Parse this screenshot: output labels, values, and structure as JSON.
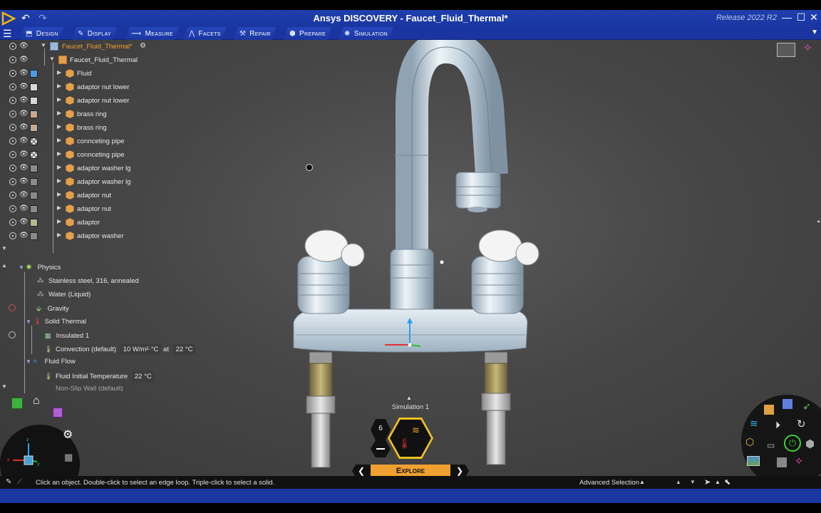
{
  "window": {
    "title": "Ansys DISCOVERY - Faucet_Fluid_Thermal*",
    "release": "Release 2022 R2"
  },
  "ribbon": {
    "tabs": [
      {
        "label": "Design",
        "icon": "design-icon"
      },
      {
        "label": "Display",
        "icon": "display-icon"
      },
      {
        "label": "Measure",
        "icon": "measure-icon"
      },
      {
        "label": "Facets",
        "icon": "facets-icon"
      },
      {
        "label": "Repair",
        "icon": "repair-icon"
      },
      {
        "label": "Prepare",
        "icon": "prepare-icon"
      },
      {
        "label": "Simulation",
        "icon": "simulation-icon"
      }
    ]
  },
  "tree": {
    "root": "Faucet_Fluid_Thermal*",
    "child": "Faucet_Fluid_Thermal",
    "items": [
      {
        "label": "Fluid",
        "color": "#4b9be0"
      },
      {
        "label": "adaptor nut lower",
        "color": "#d8d8d8"
      },
      {
        "label": "adaptor nut lower",
        "color": "#d8d8d8"
      },
      {
        "label": "brass ring",
        "color": "#c8a890"
      },
      {
        "label": "brass ring",
        "color": "#c8a890"
      },
      {
        "label": "connceting pipe",
        "color": "checker"
      },
      {
        "label": "connceting pipe",
        "color": "checker"
      },
      {
        "label": "adaptor washer lg",
        "color": "#8a8a8a"
      },
      {
        "label": "adaptor washer lg",
        "color": "#8a8a8a"
      },
      {
        "label": "adaptor nut",
        "color": "#8a8a8a"
      },
      {
        "label": "adaptor nut",
        "color": "#8a8a8a"
      },
      {
        "label": "adaptor",
        "color": "#b8b890"
      },
      {
        "label": "adaptor washer",
        "color": "#8a8a8a"
      }
    ]
  },
  "physics": {
    "title": "Physics",
    "materials": [
      "Stainless steel, 316, annealed",
      "Water (Liquid)"
    ],
    "gravity": "Gravity",
    "solid_thermal": "Solid Thermal",
    "insulated": "Insulated 1",
    "convection": {
      "label": "Convection (default)",
      "coefficient": "10 W/m²·°C",
      "at": "at",
      "temp": "22 °C"
    },
    "fluid_flow": "Fluid Flow",
    "fluid_initial": {
      "label": "Fluid Initial Temperature",
      "value": "22 °C"
    },
    "next_partial": "Non-Slip Wall (default)"
  },
  "simulation": {
    "name": "Simulation 1",
    "mode": "Explore",
    "fidelity": "6"
  },
  "status": {
    "hint": "Click an object. Double-click to select an edge loop. Triple-click to select a solid.",
    "selection_mode": "Advanced Selection"
  },
  "triad": {
    "x": "x",
    "y": "y",
    "z": "z"
  },
  "colors": {
    "accent_blue": "#1a36a0",
    "explore_orange": "#f0a030",
    "root_orange": "#f0a030"
  }
}
